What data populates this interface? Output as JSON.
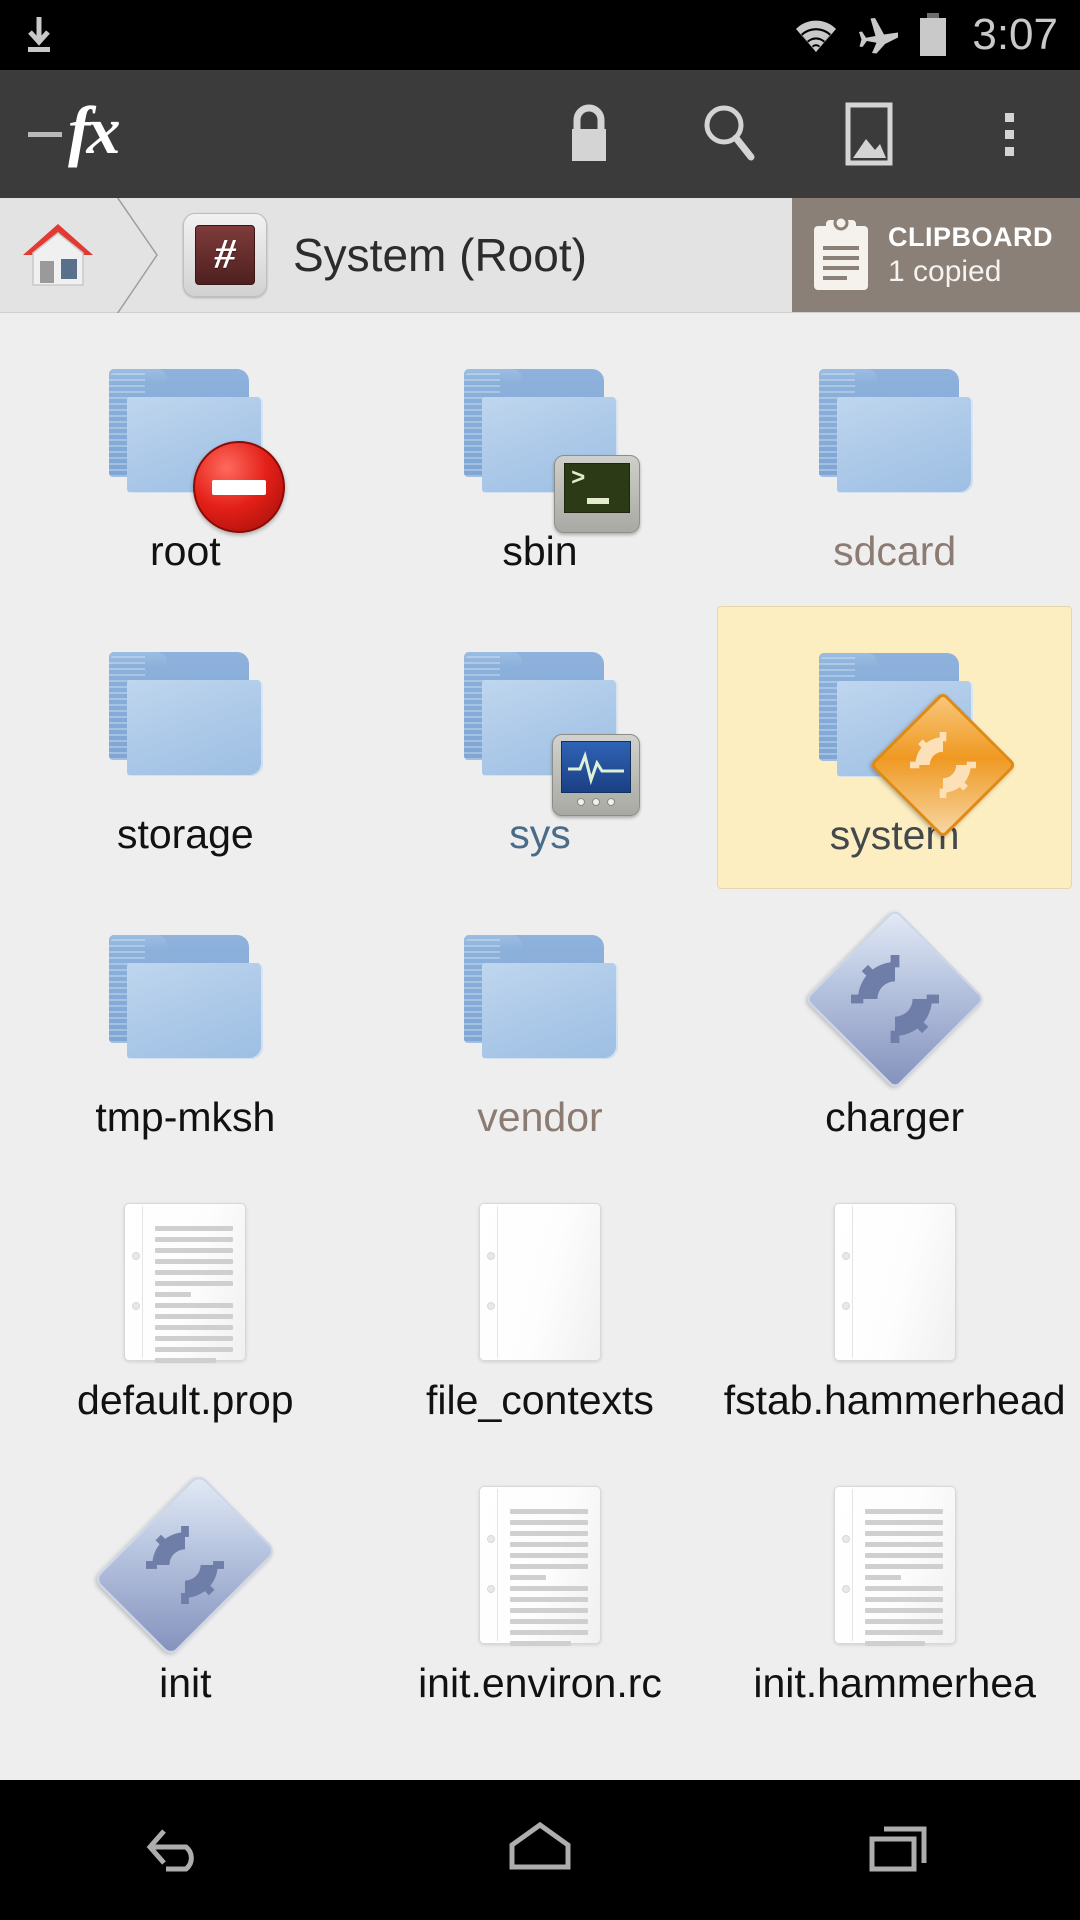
{
  "statusbar": {
    "time": "3:07",
    "icons": [
      "download-icon",
      "wifi-icon",
      "airplane-mode-icon",
      "battery-icon"
    ]
  },
  "appbar": {
    "logo": "fx",
    "actions": [
      {
        "name": "lock-icon",
        "label": "Lock"
      },
      {
        "name": "search-icon",
        "label": "Search"
      },
      {
        "name": "image-icon",
        "label": "Gallery"
      },
      {
        "name": "overflow-menu-icon",
        "label": "More options"
      }
    ]
  },
  "breadcrumb": {
    "home_label": "Home",
    "root_badge": "#",
    "title": "System (Root)"
  },
  "clipboard": {
    "title": "CLIPBOARD",
    "subtitle": "1 copied"
  },
  "colors": {
    "statusbar_bg": "#000000",
    "appbar_bg": "#3b3b3b",
    "breadcrumb_bg": "#e3e3e3",
    "clipboard_bg": "#8b8077",
    "grid_bg": "#eeeeee",
    "selection_bg": "#fdeec1",
    "folder_blue": "#abc8e8",
    "symlink_text": "#8c7b72",
    "sys_text": "#4a6b8a",
    "root_badge_red": "#4f2020",
    "stop_badge_red": "#e32018",
    "system_badge_orange": "#ef9922"
  },
  "files": [
    {
      "name": "root",
      "type": "folder",
      "badge": "stop-badge",
      "label_style": "normal",
      "selected": false
    },
    {
      "name": "sbin",
      "type": "folder",
      "badge": "terminal-badge",
      "label_style": "normal",
      "selected": false
    },
    {
      "name": "sdcard",
      "type": "folder",
      "badge": "none",
      "label_style": "symlink",
      "selected": false
    },
    {
      "name": "storage",
      "type": "folder",
      "badge": "none",
      "label_style": "normal",
      "selected": false
    },
    {
      "name": "sys",
      "type": "folder",
      "badge": "monitor-badge",
      "label_style": "system",
      "selected": false
    },
    {
      "name": "system",
      "type": "folder",
      "badge": "gear-diamond-badge",
      "label_style": "selected",
      "selected": true
    },
    {
      "name": "tmp-mksh",
      "type": "folder",
      "badge": "none",
      "label_style": "normal",
      "selected": false
    },
    {
      "name": "vendor",
      "type": "folder",
      "badge": "none",
      "label_style": "symlink",
      "selected": false
    },
    {
      "name": "charger",
      "type": "executable",
      "badge": "none",
      "label_style": "normal",
      "selected": false
    },
    {
      "name": "default.prop",
      "type": "document-filled",
      "badge": "none",
      "label_style": "normal",
      "selected": false
    },
    {
      "name": "file_contexts",
      "type": "document-empty",
      "badge": "none",
      "label_style": "normal",
      "selected": false
    },
    {
      "name": "fstab.hammerhead",
      "type": "document-empty",
      "badge": "none",
      "label_style": "normal",
      "selected": false
    },
    {
      "name": "init",
      "type": "executable-tall",
      "badge": "none",
      "label_style": "normal",
      "selected": false
    },
    {
      "name": "init.environ.rc",
      "type": "document-filled",
      "badge": "none",
      "label_style": "normal",
      "selected": false
    },
    {
      "name": "init.hammerhea",
      "type": "document-filled",
      "badge": "none",
      "label_style": "normal",
      "selected": false
    }
  ],
  "navbar": {
    "buttons": [
      {
        "name": "back-button",
        "label": "Back"
      },
      {
        "name": "home-button",
        "label": "Home"
      },
      {
        "name": "recents-button",
        "label": "Recents"
      }
    ]
  }
}
